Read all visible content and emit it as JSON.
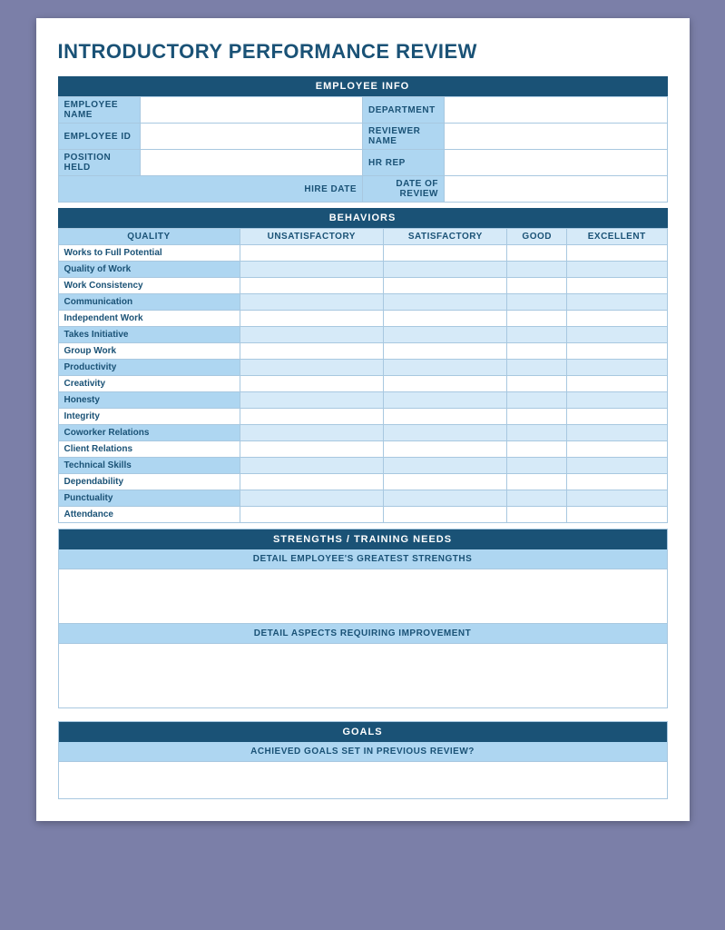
{
  "title": "INTRODUCTORY PERFORMANCE REVIEW",
  "employee_info": {
    "section_header": "EMPLOYEE INFO",
    "labels": {
      "employee_name": "EMPLOYEE NAME",
      "employee_id": "EMPLOYEE ID",
      "position_held": "POSITION HELD",
      "department": "DEPARTMENT",
      "reviewer_name": "REVIEWER NAME",
      "hr_rep": "HR REP",
      "hire_date": "HIRE DATE",
      "date_of_review": "DATE OF REVIEW"
    }
  },
  "behaviors": {
    "section_header": "BEHAVIORS",
    "col_quality": "QUALITY",
    "col_unsatisfactory": "UNSATISFACTORY",
    "col_satisfactory": "SATISFACTORY",
    "col_good": "GOOD",
    "col_excellent": "EXCELLENT",
    "rows": [
      "Works to Full Potential",
      "Quality of Work",
      "Work Consistency",
      "Communication",
      "Independent Work",
      "Takes Initiative",
      "Group Work",
      "Productivity",
      "Creativity",
      "Honesty",
      "Integrity",
      "Coworker Relations",
      "Client Relations",
      "Technical Skills",
      "Dependability",
      "Punctuality",
      "Attendance"
    ]
  },
  "strengths": {
    "section_header": "STRENGTHS / TRAINING NEEDS",
    "strengths_subheader": "DETAIL EMPLOYEE'S GREATEST STRENGTHS",
    "improvement_subheader": "DETAIL ASPECTS REQUIRING IMPROVEMENT"
  },
  "goals": {
    "section_header": "GOALS",
    "subheader": "ACHIEVED GOALS SET IN PREVIOUS REVIEW?"
  }
}
